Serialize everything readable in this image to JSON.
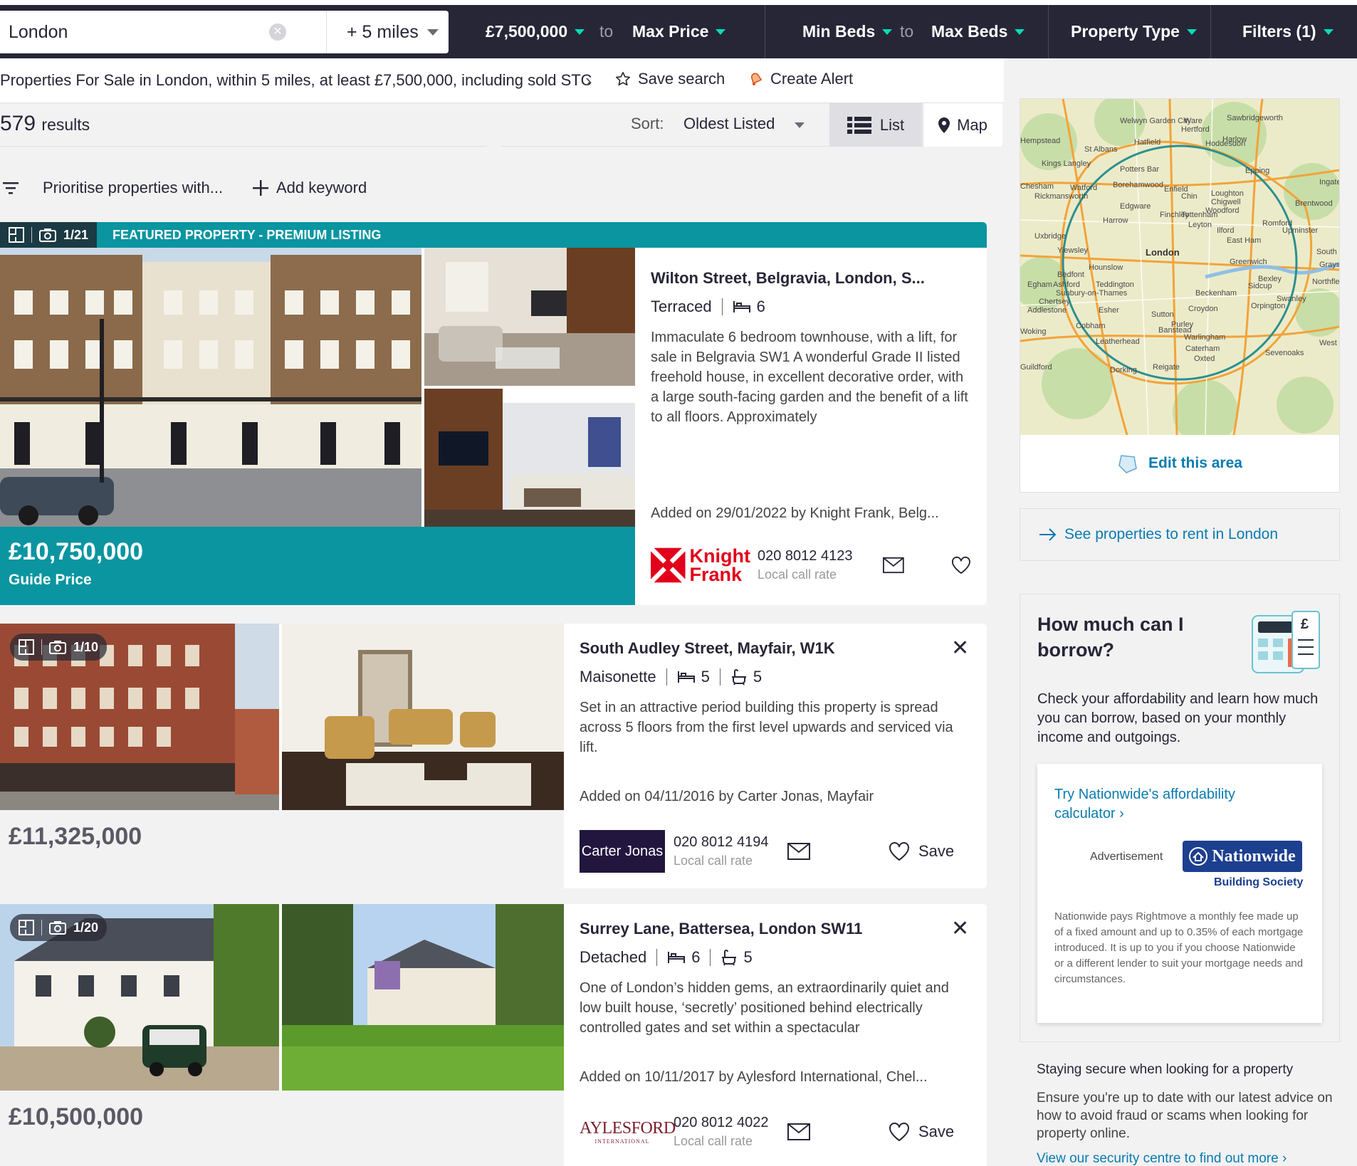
{
  "search": {
    "location": "London",
    "radius": "+ 5 miles",
    "min_price": "£7,500,000",
    "to_label": "to",
    "max_price": "Max Price",
    "min_beds": "Min Beds",
    "max_beds": "Max Beds",
    "property_type": "Property Type",
    "filters": "Filters (1)"
  },
  "breadcrumb": {
    "text": "Properties For Sale in London, within 5 miles, at least £7,500,000, including sold STC",
    "save_search": "Save search",
    "create_alert": "Create Alert"
  },
  "results": {
    "count": "579",
    "count_label": "results",
    "sort_label": "Sort:",
    "sort_value": "Oldest Listed",
    "list_label": "List",
    "map_label": "Map"
  },
  "keywords": {
    "prioritise": "Prioritise properties with...",
    "add_keyword": "Add keyword"
  },
  "listings": [
    {
      "featured_label": "FEATURED PROPERTY - PREMIUM LISTING",
      "image_count": "1/21",
      "address": "Wilton Street, Belgravia, London, S...",
      "type": "Terraced",
      "beds": "6",
      "description": "Immaculate 6 bedroom townhouse, with a lift, for sale in Belgravia SW1 A wonderful Grade II listed freehold house, in excellent decorative order, with a large south-facing garden and the benefit of a lift to all floors. Approximately",
      "added": "Added on 29/01/2022 by Knight Frank, Belg...",
      "price": "£10,750,000",
      "price_qualifier": "Guide Price",
      "agent_logo_line1": "Knight",
      "agent_logo_line2": "Frank",
      "phone": "020 8012 4123",
      "call_rate": "Local call rate"
    },
    {
      "image_count": "1/10",
      "address": "South Audley Street, Mayfair, W1K",
      "type": "Maisonette",
      "beds": "5",
      "baths": "5",
      "description": "Set in an attractive period building this property is spread across 5 floors from the first level upwards and serviced via lift.",
      "added": "Added on 04/11/2016 by Carter Jonas, Mayfair",
      "price": "£11,325,000",
      "agent_logo": "Carter Jonas",
      "phone": "020 8012 4194",
      "call_rate": "Local call rate",
      "save": "Save"
    },
    {
      "image_count": "1/20",
      "address": "Surrey Lane, Battersea, London SW11",
      "type": "Detached",
      "beds": "6",
      "baths": "5",
      "description": "One of London’s hidden gems, an extraordinarily quiet and low built house, ‘secretly’ positioned behind electrically controlled gates and set within a spectacular",
      "added": "Added on 10/11/2017 by Aylesford International, Chel...",
      "price": "£10,500,000",
      "agent_logo_line1": "AYLESFORD",
      "agent_logo_line2": "INTERNATIONAL",
      "phone": "020 8012 4022",
      "call_rate": "Local call rate",
      "save": "Save"
    }
  ],
  "sidebar": {
    "map_places": [
      "Welwyn Garden City",
      "Ware",
      "Sawbridgeworth",
      "Hertford",
      "Hatfield",
      "Hoddesdon",
      "Harlow",
      "St Albans",
      "Kings Langley",
      "Potters Bar",
      "Epping",
      "Watford",
      "Borehamwood",
      "Enfield",
      "Loughton",
      "Chigwell",
      "Woodford",
      "Brentwood",
      "Rickmansworth",
      "Edgware",
      "Finchley",
      "Tottenham",
      "Chin",
      "Harrow",
      "Leyton",
      "Ilford",
      "Romford",
      "Upminster",
      "East Ham",
      "Uxbridge",
      "Yiewsley",
      "London",
      "Greenwich",
      "Hounslow",
      "Bedfont",
      "Teddington",
      "Bexley",
      "Sidcup",
      "Beckenham",
      "Egham",
      "Ashford",
      "Sunbury-on-Thames",
      "Chertsey",
      "Addlestone",
      "Esher",
      "Sutton",
      "Croydon",
      "Orpington",
      "Swanley",
      "Purley",
      "Banstead",
      "Cobham",
      "Woking",
      "Leatherhead",
      "Warlingham",
      "Caterham",
      "Oxted",
      "Sevenoaks",
      "Dorking",
      "Reigate",
      "Guildford",
      "Northfleet",
      "Grays",
      "South Ockendon",
      "Ingatestone",
      "West",
      "Hempstead",
      "Chesham"
    ],
    "edit_area": "Edit this area",
    "rent_link": "See properties to rent in London",
    "borrow_title": "How much can I borrow?",
    "borrow_text": "Check your affordability and learn how much you can borrow, based on your monthly income and outgoings.",
    "ad_link": "Try Nationwide's affordability calculator ›",
    "ad_label": "Advertisement",
    "ad_logo": "Nationwide",
    "ad_logo_sub": "Building Society",
    "ad_disclaimer": "Nationwide pays Rightmove a monthly fee made up of a fixed amount and up to 0.35% of each mortgage introduced. It is up to you if you choose Nationwide or a different lender to suit your mortgage needs and circumstances.",
    "secure_title": "Staying secure when looking for a property",
    "secure_text": "Ensure you're up to date with our latest advice on how to avoid fraud or scams when looking for property online.",
    "secure_link": "View our security centre to find out more ›"
  },
  "colors": {
    "nav_dark": "#262637",
    "teal": "#0a95a1",
    "accent_caret": "#00deb6",
    "link_blue": "#0a7bb0",
    "knight_frank_red": "#e2001a",
    "carter_jonas_navy": "#22163f"
  }
}
